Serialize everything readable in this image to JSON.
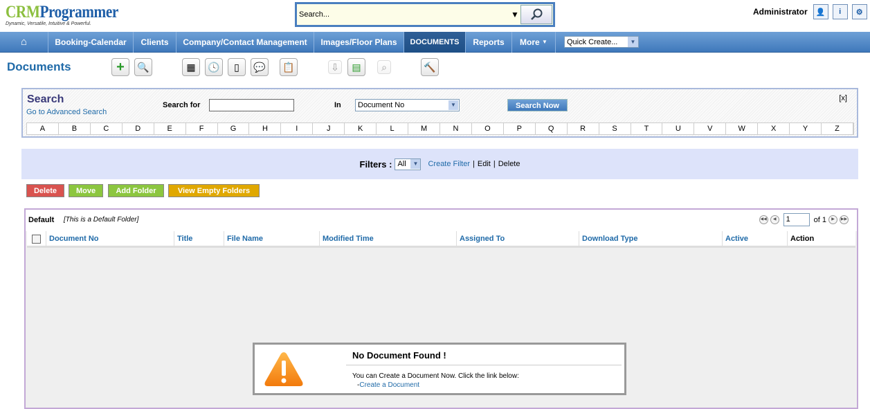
{
  "brand": {
    "name_part1": "CRM",
    "name_part2": "Programmer",
    "tagline": "Dynamic, Versatile, Intuitive & Powerful."
  },
  "global_search": {
    "placeholder": "Search..."
  },
  "user": {
    "name": "Administrator"
  },
  "nav": {
    "items": [
      "Booking-Calendar",
      "Clients",
      "Company/Contact Management",
      "Images/Floor Plans",
      "DOCUMENTS",
      "Reports",
      "More"
    ],
    "active": "DOCUMENTS",
    "quick_create": "Quick Create..."
  },
  "page": {
    "title": "Documents"
  },
  "search": {
    "title": "Search",
    "advanced_link": "Go to Advanced Search",
    "search_for_label": "Search for",
    "search_for_value": "",
    "in_label": "In",
    "in_value": "Document No",
    "button": "Search Now",
    "close": "[x]",
    "letters": [
      "A",
      "B",
      "C",
      "D",
      "E",
      "F",
      "G",
      "H",
      "I",
      "J",
      "K",
      "L",
      "M",
      "N",
      "O",
      "P",
      "Q",
      "R",
      "S",
      "T",
      "U",
      "V",
      "W",
      "X",
      "Y",
      "Z"
    ]
  },
  "filters": {
    "label": "Filters :",
    "selected": "All",
    "create": "Create Filter",
    "sep": "|",
    "edit": "Edit",
    "delete": "Delete"
  },
  "actions": {
    "delete": "Delete",
    "move": "Move",
    "add_folder": "Add Folder",
    "view_empty": "View Empty Folders"
  },
  "colors": {
    "delete": "#d9534f",
    "move": "#8cc63f",
    "add_folder": "#8cc63f",
    "view_empty": "#e0a800",
    "accent": "#1f6aa8"
  },
  "folder": {
    "name": "Default",
    "description": "[This is a Default Folder]",
    "page": "1",
    "page_total": "of 1"
  },
  "table": {
    "columns": [
      "Document No",
      "Title",
      "File Name",
      "Modified Time",
      "Assigned To",
      "Download Type",
      "Active",
      "Action"
    ]
  },
  "empty": {
    "title": "No Document Found !",
    "message": "You can Create a Document Now. Click the link below:",
    "link_prefix": "-",
    "link": "Create a Document"
  }
}
